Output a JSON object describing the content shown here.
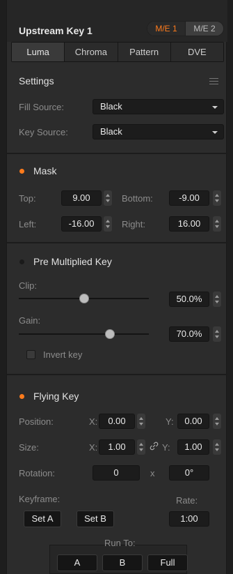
{
  "header": {
    "title": "Upstream Key 1",
    "me_buttons": [
      "M/E 1",
      "M/E 2"
    ],
    "active_me": "M/E 1",
    "accent_color": "#ff7b1c"
  },
  "tabs": [
    {
      "label": "Luma",
      "active": true
    },
    {
      "label": "Chroma",
      "active": false
    },
    {
      "label": "Pattern",
      "active": false
    },
    {
      "label": "DVE",
      "active": false
    }
  ],
  "settings": {
    "title": "Settings",
    "menu_icon": "menu-icon",
    "fill_source_label": "Fill Source:",
    "fill_source_value": "Black",
    "key_source_label": "Key Source:",
    "key_source_value": "Black"
  },
  "mask": {
    "title": "Mask",
    "enabled": true,
    "top_label": "Top:",
    "top_value": "9.00",
    "bottom_label": "Bottom:",
    "bottom_value": "-9.00",
    "left_label": "Left:",
    "left_value": "-16.00",
    "right_label": "Right:",
    "right_value": "16.00"
  },
  "pre_multiplied": {
    "title": "Pre Multiplied Key",
    "enabled": false,
    "clip_label": "Clip:",
    "clip_value": "50.0%",
    "clip_fraction": 0.5,
    "gain_label": "Gain:",
    "gain_value": "70.0%",
    "gain_fraction": 0.7,
    "invert_label": "Invert key",
    "invert_checked": false
  },
  "flying_key": {
    "title": "Flying Key",
    "enabled": true,
    "position_label": "Position:",
    "position_x_label": "X:",
    "position_x": "0.00",
    "position_y_label": "Y:",
    "position_y": "0.00",
    "size_label": "Size:",
    "size_x_label": "X:",
    "size_x": "1.00",
    "size_y_label": "Y:",
    "size_y": "1.00",
    "link_icon": "link-icon",
    "rotation_label": "Rotation:",
    "rotation_value": "0",
    "rotation_x_label": "x",
    "rotation_degrees": "0°",
    "keyframe_label": "Keyframe:",
    "set_a": "Set A",
    "set_b": "Set B",
    "rate_label": "Rate:",
    "rate_value": "1:00",
    "run_to_label": "Run To:",
    "run_to_buttons": [
      "A",
      "B",
      "Full"
    ]
  }
}
